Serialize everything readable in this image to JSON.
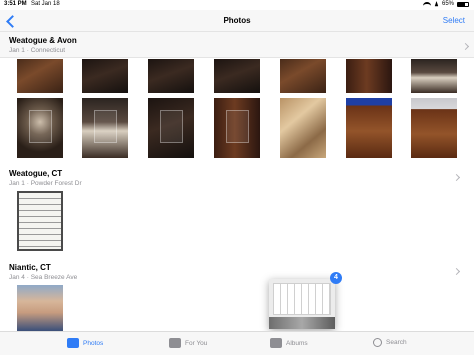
{
  "status_bar": {
    "time": "3:51 PM",
    "date": "Sat Jan 18",
    "battery": "65%",
    "battery_level": 0.65
  },
  "nav": {
    "title": "Photos",
    "select_label": "Select",
    "back_icon": "chevron-left-icon"
  },
  "sections": [
    {
      "title": "Weatogue & Avon",
      "date": "Jan 1",
      "place": "Connecticut"
    },
    {
      "title": "Weatogue, CT",
      "date": "Jan 1",
      "place": "Powder Forest Dr"
    },
    {
      "title": "Niantic, CT",
      "date": "Jan 4",
      "place": "Sea Breeze Ave"
    }
  ],
  "separator": "·",
  "drag": {
    "count": "4"
  },
  "tabs": [
    {
      "label": "Photos",
      "icon": "photos-icon",
      "active": true
    },
    {
      "label": "For You",
      "icon": "for-you-icon",
      "active": false
    },
    {
      "label": "Albums",
      "icon": "albums-icon",
      "active": false
    },
    {
      "label": "Search",
      "icon": "search-icon",
      "active": false
    }
  ],
  "colors": {
    "accent": "#2f7cf6",
    "secondary_text": "#8e8e93",
    "bar_bg": "#f7f7f7"
  }
}
